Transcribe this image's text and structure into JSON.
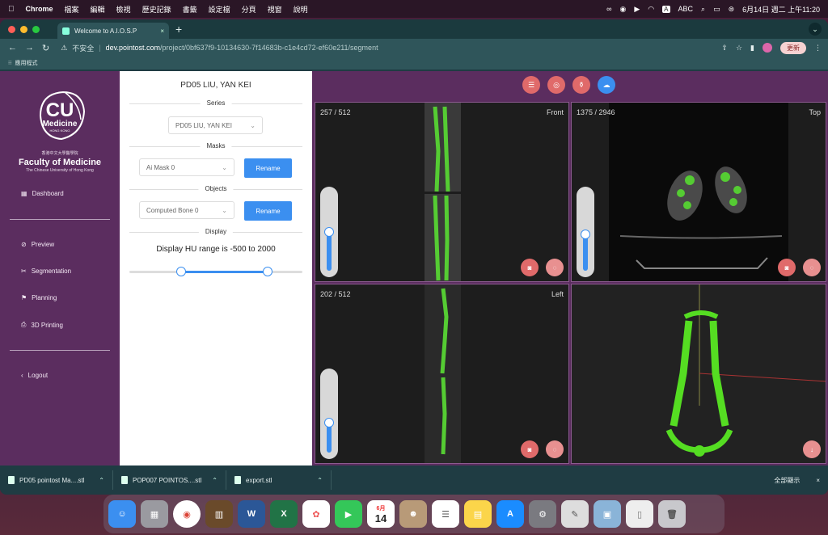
{
  "menubar": {
    "apple": "",
    "app": "Chrome",
    "items": [
      "檔案",
      "編輯",
      "檢視",
      "歷史記錄",
      "書籤",
      "設定檔",
      "分頁",
      "視窗",
      "說明"
    ],
    "input_method": "ABC",
    "datetime": "6月14日 週二 上午11:20"
  },
  "browser": {
    "tab_title": "Welcome to A.I.O.S.P",
    "security": "不安全",
    "url_host": "dev.pointost.com",
    "url_path": "/project/0bf637f9-10134630-7f14683b-c1e4cd72-ef60e211/segment",
    "update_label": "更新",
    "bookmarks_label": "應用程式"
  },
  "sidebar": {
    "logo_text": "CU",
    "logo_sub": "Medicine",
    "logo_sub2": "HONG KONG",
    "faculty_cn": "香港中文大學醫學院",
    "faculty": "Faculty of Medicine",
    "university": "The Chinese University of Hong Kong",
    "items": [
      {
        "label": "Dashboard"
      },
      {
        "label": "Preview"
      },
      {
        "label": "Segmentation"
      },
      {
        "label": "Planning"
      },
      {
        "label": "3D Printing"
      },
      {
        "label": "Logout"
      }
    ]
  },
  "panel": {
    "patient": "PD05 LIU, YAN KEI",
    "series_heading": "Series",
    "series_value": "PD05 LIU, YAN KEI",
    "masks_heading": "Masks",
    "mask_value": "Ai Mask 0",
    "rename_label": "Rename",
    "objects_heading": "Objects",
    "object_value": "Computed Bone 0",
    "display_heading": "Display",
    "hu_text": "Display HU range is -500 to 2000",
    "hu_min_fraction": 0.3,
    "hu_max_fraction": 0.8
  },
  "viewer": {
    "front": {
      "counter": "257 / 512",
      "label": "Front",
      "level": 0.5
    },
    "top": {
      "counter": "1375 / 2946",
      "label": "Top",
      "level": 0.47
    },
    "left": {
      "counter": "202 / 512",
      "label": "Left",
      "level": 0.39
    }
  },
  "downloads": {
    "items": [
      "PD05 pointost Ma....stl",
      "POP007 POINTOS....stl",
      "export.stl"
    ],
    "show_all": "全部顯示"
  },
  "dock": {
    "calendar_month": "6月",
    "calendar_day": "14"
  }
}
